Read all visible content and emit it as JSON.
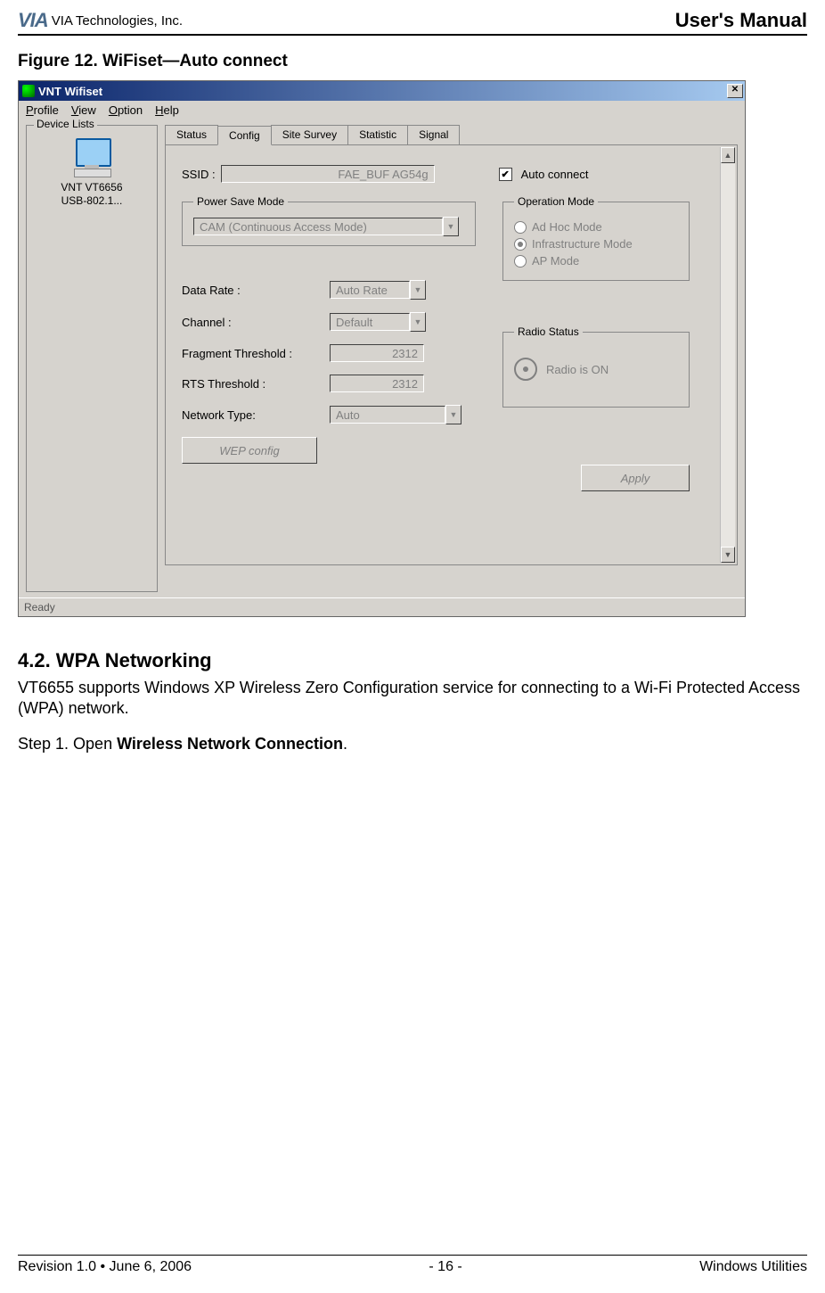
{
  "header": {
    "company": "VIA Technologies, Inc.",
    "manual": "User's Manual"
  },
  "figure_title": "Figure 12. WiFiset—Auto connect",
  "app": {
    "title": "VNT Wifiset",
    "menus": {
      "profile": "Profile",
      "view": "View",
      "option": "Option",
      "help": "Help"
    },
    "device_group": "Device Lists",
    "device_name_l1": "VNT VT6656",
    "device_name_l2": "USB-802.1...",
    "tabs": {
      "status": "Status",
      "config": "Config",
      "site": "Site Survey",
      "stat": "Statistic",
      "signal": "Signal"
    },
    "ssid_label": "SSID :",
    "ssid_value": "FAE_BUF AG54g",
    "auto_connect": "Auto connect",
    "power_save": {
      "legend": "Power Save Mode",
      "value": "CAM (Continuous Access Mode)"
    },
    "operation": {
      "legend": "Operation Mode",
      "adhoc": "Ad Hoc Mode",
      "infra": "Infrastructure Mode",
      "ap": "AP Mode"
    },
    "fields": {
      "data_rate_l": "Data Rate :",
      "data_rate_v": "Auto Rate",
      "channel_l": "Channel :",
      "channel_v": "Default",
      "frag_l": "Fragment Threshold :",
      "frag_v": "2312",
      "rts_l": "RTS Threshold :",
      "rts_v": "2312",
      "net_l": "Network Type:",
      "net_v": "Auto"
    },
    "radio": {
      "legend": "Radio Status",
      "text": "Radio is ON"
    },
    "buttons": {
      "wep": "WEP config",
      "apply": "Apply"
    },
    "status": "Ready"
  },
  "section": {
    "heading": "4.2. WPA Networking",
    "p1": "VT6655 supports Windows XP Wireless Zero Configuration service for connecting to a Wi-Fi Protected Access (WPA) network.",
    "p2a": "Step 1. Open ",
    "p2b": "Wireless Network Connection",
    "p2c": "."
  },
  "footer": {
    "left": "Revision 1.0 • June 6, 2006",
    "center": "- 16 -",
    "right": "Windows Utilities"
  }
}
